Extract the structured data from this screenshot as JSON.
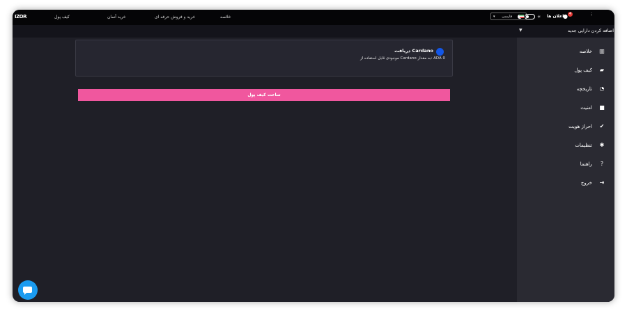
{
  "topnav": {
    "logo": "IZOR",
    "links": [
      "کیف پول",
      "خرید آسان",
      "خرید و فروش حرفه ای",
      "خلاصه"
    ],
    "language": "فارسی",
    "notifications_label": "اعلان ها",
    "notifications_count": "4"
  },
  "subbar": {
    "add_asset": "اضافه کردن دارایی جدید"
  },
  "sidebar": {
    "items": [
      {
        "label": "خلاصه",
        "icon": "bar-chart-icon"
      },
      {
        "label": "کیف پول",
        "icon": "wallet-icon"
      },
      {
        "label": "تاریخچه",
        "icon": "history-icon"
      },
      {
        "label": "امنیت",
        "icon": "lock-icon"
      },
      {
        "label": "احراز هویت",
        "icon": "check-circle-icon"
      },
      {
        "label": "تنظیمات",
        "icon": "gear-icon"
      },
      {
        "label": "راهنما",
        "icon": "help-icon"
      },
      {
        "label": "خروج",
        "icon": "logout-icon"
      }
    ]
  },
  "card": {
    "title": "دریافت Cardano",
    "subtitle": "موجودی قابل استفاده از Cardano به مقدار: ADA 0"
  },
  "create_button": {
    "label": "ساخت کیف پول"
  },
  "colors": {
    "accent": "#f0579e",
    "coin": "#1357e8",
    "chat": "#1a9bf0"
  }
}
